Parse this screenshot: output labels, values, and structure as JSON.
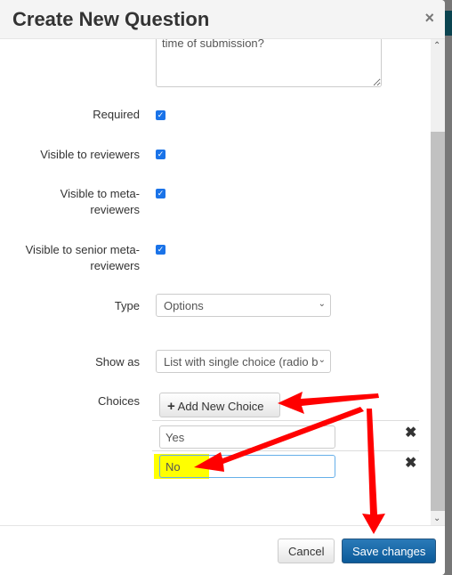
{
  "dialog": {
    "title": "Create New Question",
    "close_label": "×"
  },
  "form": {
    "question_text_tail": "time of submission?",
    "required_label": "Required",
    "required": true,
    "visible_reviewers_label": "Visible to reviewers",
    "visible_reviewers": true,
    "visible_meta_label": "Visible to meta-reviewers",
    "visible_meta": true,
    "visible_senior_label": "Visible to senior meta-reviewers",
    "visible_senior": true,
    "type_label": "Type",
    "type_value": "Options",
    "show_as_label": "Show as",
    "show_as_value": "List with single choice (radio b",
    "choices_label": "Choices",
    "add_choice_label": "Add New Choice",
    "choices": [
      {
        "value": "Yes"
      },
      {
        "value": "No"
      }
    ]
  },
  "footer": {
    "cancel_label": "Cancel",
    "save_label": "Save changes"
  },
  "annotations": {
    "arrow_color": "#ff0000",
    "highlight_color": "#ffff00"
  }
}
